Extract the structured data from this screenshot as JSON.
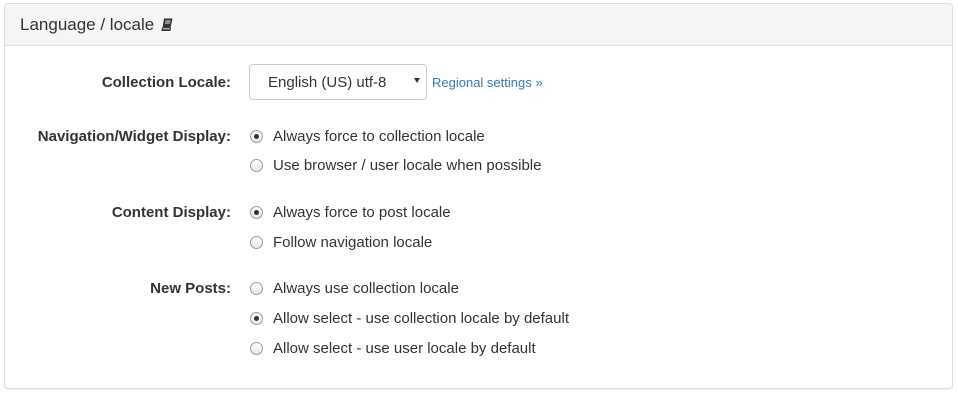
{
  "panel": {
    "title": "Language / locale",
    "title_icon": "book-icon"
  },
  "collection_locale": {
    "label": "Collection Locale:",
    "selected": "English (US) utf-8",
    "link": "Regional settings »"
  },
  "navigation_display": {
    "label": "Navigation/Widget Display:",
    "options": [
      {
        "label": "Always force to collection locale",
        "checked": true
      },
      {
        "label": "Use browser / user locale when possible",
        "checked": false
      }
    ]
  },
  "content_display": {
    "label": "Content Display:",
    "options": [
      {
        "label": "Always force to post locale",
        "checked": true
      },
      {
        "label": "Follow navigation locale",
        "checked": false
      }
    ]
  },
  "new_posts": {
    "label": "New Posts:",
    "options": [
      {
        "label": "Always use collection locale",
        "checked": false
      },
      {
        "label": "Allow select - use collection locale by default",
        "checked": true
      },
      {
        "label": "Allow select - use user locale by default",
        "checked": false
      }
    ]
  }
}
